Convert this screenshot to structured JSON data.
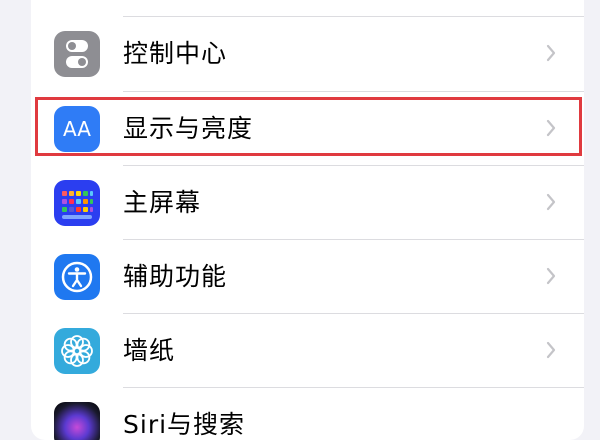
{
  "settings": {
    "items": [
      {
        "label": "",
        "icon": "general-icon"
      },
      {
        "label": "控制中心",
        "icon": "control-center-icon"
      },
      {
        "label": "显示与亮度",
        "icon": "display-brightness-icon",
        "icon_text": "AA"
      },
      {
        "label": "主屏幕",
        "icon": "home-screen-icon"
      },
      {
        "label": "辅助功能",
        "icon": "accessibility-icon"
      },
      {
        "label": "墙纸",
        "icon": "wallpaper-icon"
      },
      {
        "label": "Siri与搜索",
        "icon": "siri-icon"
      }
    ]
  },
  "colors": {
    "highlight": "#e03a3f",
    "control_center_bg": "#8e8e93",
    "display_bg": "#2f7cf6",
    "home_screen_bg": "#2b3ef0",
    "accessibility_bg": "#1f78f0",
    "wallpaper_bg": "#34aadc"
  }
}
